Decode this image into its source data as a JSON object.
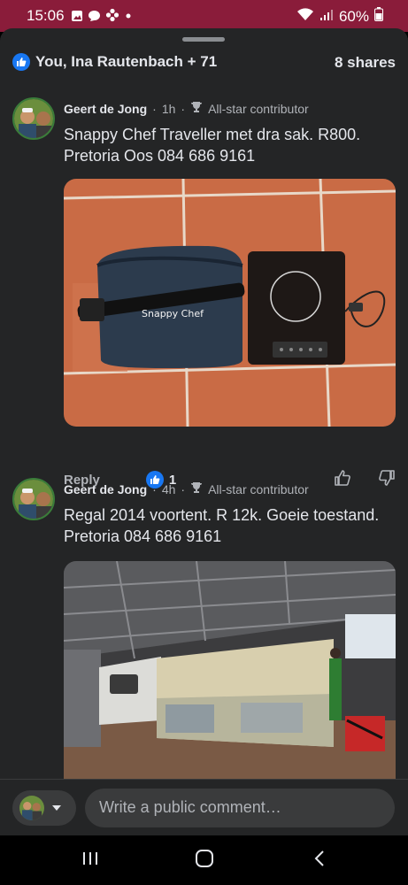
{
  "status": {
    "time": "15:06",
    "battery": "60%"
  },
  "reactions": {
    "summary": "You, Ina Rautenbach + 71",
    "shares": "8 shares"
  },
  "comments": [
    {
      "author": "Geert de Jong",
      "age": "1h",
      "badge": "All-star contributor",
      "text": "Snappy Chef Traveller met dra sak. R800. Pretoria Oos 084 686 9161",
      "photo_label": "Snappy Chef",
      "reply_label": "Reply",
      "like_count": "1"
    },
    {
      "author": "Geert de Jong",
      "age": "4h",
      "badge": "All-star contributor",
      "text": "Regal 2014 voortent. R 12k. Goeie toestand. Pretoria 084 686 9161"
    }
  ],
  "composer": {
    "placeholder": "Write a public comment…"
  },
  "colors": {
    "status_bar": "#8a1c3a",
    "sheet": "#242526",
    "accent": "#1877f2"
  },
  "icons": [
    "gallery-icon",
    "chat-icon",
    "flower-icon",
    "dot-icon",
    "wifi-icon",
    "signal-icon",
    "battery-icon",
    "like-icon",
    "trophy-icon",
    "thumbs-up-icon",
    "thumbs-down-icon",
    "chevron-down-icon",
    "recents-icon",
    "home-icon",
    "back-icon"
  ]
}
